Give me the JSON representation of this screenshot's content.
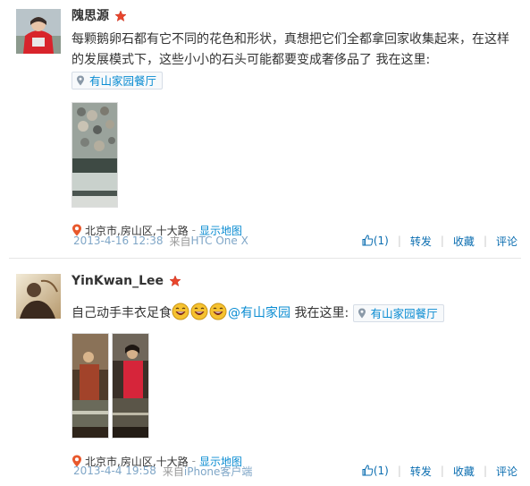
{
  "posts": [
    {
      "username": "隗思源",
      "text": "每颗鹅卵石都有它不同的花色和形状，真想把它们全都拿回家收集起来，在这样的发展模式下，这些小小的石头可能都要变成奢侈品了 我在这里:",
      "place": "有山家园餐厅",
      "location": "北京市,房山区,十大路",
      "location_sep": "-",
      "map_link": "显示地图",
      "time": "2013-4-16 12:38",
      "from_label": "来自",
      "client": "HTC One X",
      "like_count": "(1)",
      "repost": "转发",
      "favorite": "收藏",
      "comment": "评论",
      "separator": "|"
    },
    {
      "username": "YinKwan_Lee",
      "text": "自己动手丰衣足食",
      "mention": "@有山家园",
      "text_after": " 我在这里:",
      "place": "有山家园餐厅",
      "location": "北京市,房山区,十大路",
      "location_sep": "-",
      "map_link": "显示地图",
      "time": "2013-4-4 19:58",
      "from_label": "来自",
      "client": "iPhone客户端",
      "like_count": "(1)",
      "repost": "转发",
      "favorite": "收藏",
      "comment": "评论",
      "separator": "|"
    }
  ],
  "colors": {
    "link": "#0a8cd2",
    "meta_link": "#7fa6c7",
    "vip_star": "#e8452c",
    "location_pin": "#e8582c"
  }
}
